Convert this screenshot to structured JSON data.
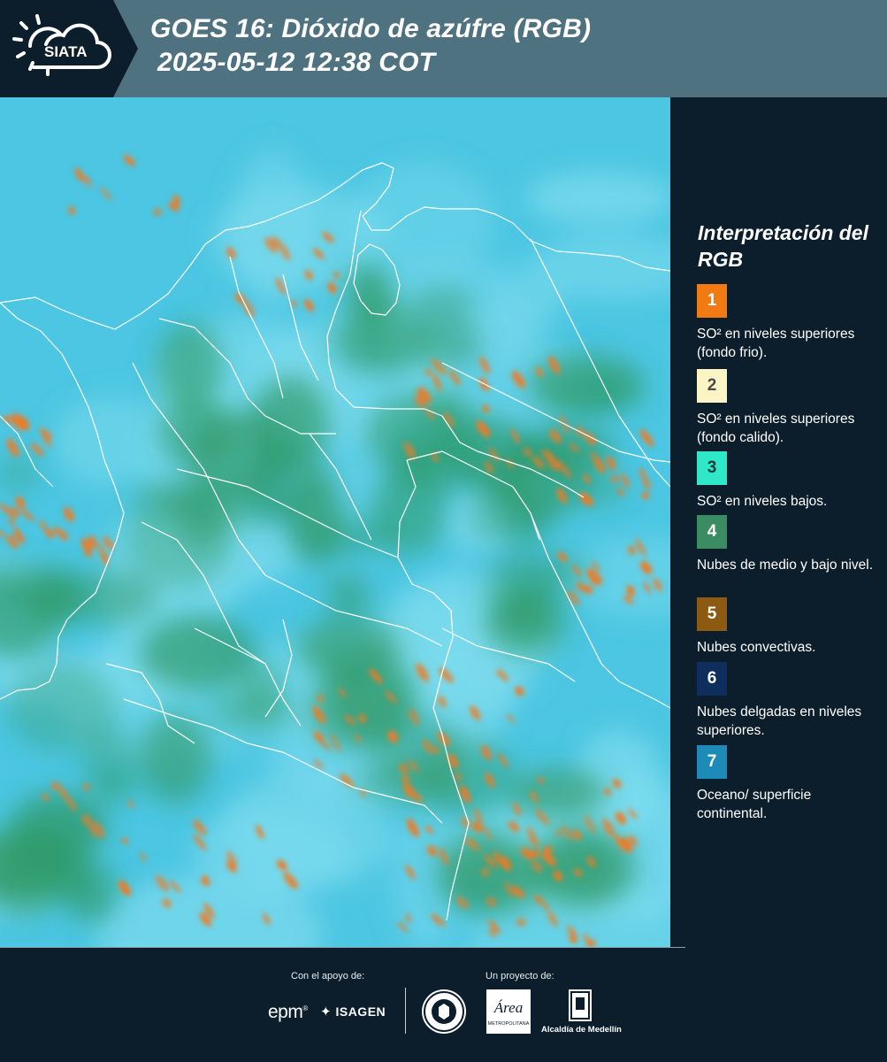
{
  "header": {
    "logo_text": "SIATA",
    "title_line1": "GOES 16: Dióxido de azúfre (RGB)",
    "title_line2": "2025-05-12 12:38 COT"
  },
  "legend": {
    "title": "Interpretación del RGB",
    "items": [
      {
        "number": "1",
        "color": "#f27a13",
        "number_color": "#ffffff",
        "description": "SO² en niveles superiores (fondo frio)."
      },
      {
        "number": "2",
        "color": "#fbf5c6",
        "number_color": "#4a4a4a",
        "description": "SO² en niveles superiores (fondo calido)."
      },
      {
        "number": "3",
        "color": "#2ee8c8",
        "number_color": "#1a3a3a",
        "description": "SO² en niveles bajos."
      },
      {
        "number": "4",
        "color": "#3a8c62",
        "number_color": "#ffffff",
        "description": "Nubes de medio y bajo nivel."
      },
      {
        "number": "5",
        "color": "#8c5a10",
        "number_color": "#ffffff",
        "description": "Nubes convectivas."
      },
      {
        "number": "6",
        "color": "#0e2f5e",
        "number_color": "#ffffff",
        "description": "Nubes delgadas en niveles superiores."
      },
      {
        "number": "7",
        "color": "#1d8ab8",
        "number_color": "#ffffff",
        "description": "Oceano/ superficie continental."
      }
    ]
  },
  "footer": {
    "support_label": "Con el apoyo de:",
    "project_label": "Un proyecto de:",
    "epm": "epm",
    "isagen": "ISAGEN",
    "alcaldia": "Alcaldía de Medellín",
    "area_text": "Área",
    "area_subtext": "METROPOLITANA"
  },
  "map": {
    "colors": {
      "background": "#4cc6e2",
      "haze": "#7fdcee",
      "vegetation": "#2f9a68",
      "convective": "#f07a22",
      "borders": "#ffffff"
    }
  }
}
